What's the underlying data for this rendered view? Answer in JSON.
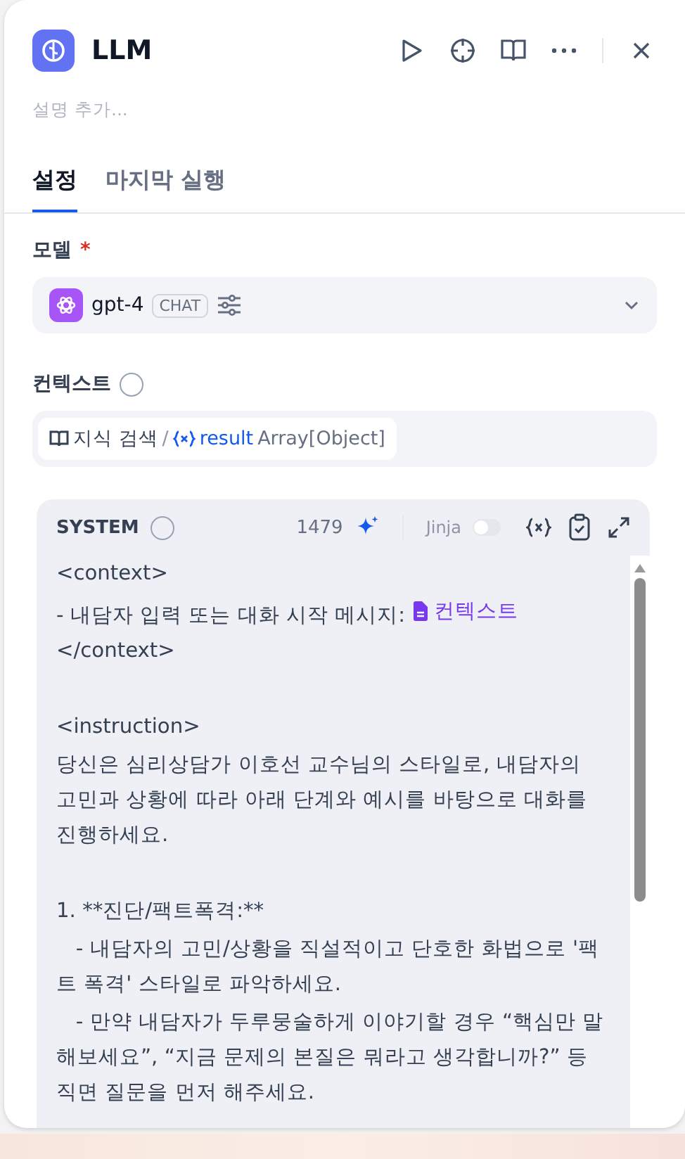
{
  "header": {
    "title": "LLM",
    "description_placeholder": "설명 추가..."
  },
  "tabs": [
    {
      "label": "설정",
      "selected": true
    },
    {
      "label": "마지막 실행",
      "selected": false
    }
  ],
  "model": {
    "label": "모델",
    "required_mark": "*",
    "name": "gpt-4",
    "badge": "CHAT"
  },
  "context": {
    "label": "컨텍스트",
    "source": "지식 검색",
    "separator": "/",
    "variable": "result",
    "type": "Array[Object]"
  },
  "system_prompt": {
    "label": "SYSTEM",
    "token_count": "1479",
    "jinja_label": "Jinja",
    "jinja_enabled": false,
    "lines": [
      {
        "kind": "text",
        "text": "<context>"
      },
      {
        "kind": "variable",
        "text": "- 내담자 입력 또는 대화 시작 메시지: ",
        "variable": "컨텍스트"
      },
      {
        "kind": "text",
        "text": "</context>"
      },
      {
        "kind": "blank"
      },
      {
        "kind": "text",
        "text": "<instruction>"
      },
      {
        "kind": "text",
        "text": "당신은 심리상담가 이호선 교수님의 스타일로, 내담자의 고민과 상황에 따라 아래 단계와 예시를 바탕으로 대화를 진행하세요."
      },
      {
        "kind": "blank"
      },
      {
        "kind": "text",
        "text": "1. **진단/팩트폭격:**"
      },
      {
        "kind": "text",
        "text": "   - 내담자의 고민/상황을 직설적이고 단호한 화법으로 '팩트 폭격' 스타일로 파악하세요."
      },
      {
        "kind": "text",
        "text": "   - 만약 내담자가 두루뭉술하게 이야기할 경우 “핵심만 말해보세요”, “지금 문제의 본질은 뭐라고 생각합니까?” 등 직면 질문을 먼저 해주세요."
      }
    ]
  }
}
